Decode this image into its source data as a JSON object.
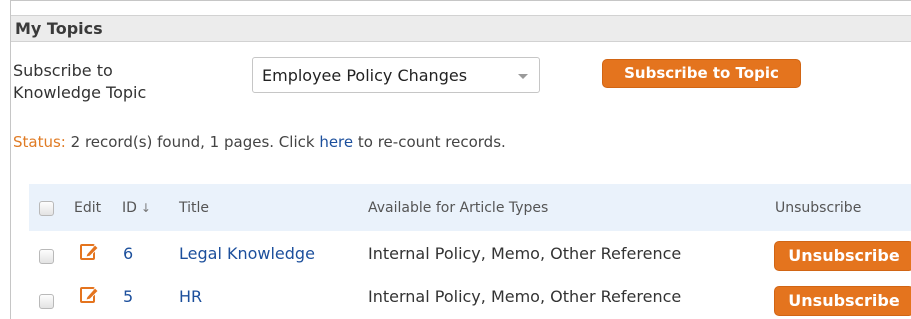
{
  "section": {
    "title": "My Topics"
  },
  "subscribe": {
    "label_line1": "Subscribe to",
    "label_line2": "Knowledge Topic",
    "selected_topic": "Employee Policy Changes",
    "button_label": "Subscribe to Topic"
  },
  "status": {
    "label": "Status:",
    "text_before_link": " 2 record(s) found, 1 pages. Click ",
    "link_text": "here",
    "text_after_link": " to re-count records."
  },
  "table": {
    "columns": {
      "edit": "Edit",
      "id": "ID",
      "title": "Title",
      "types": "Available for Article Types",
      "unsubscribe": "Unsubscribe"
    },
    "sort_icon": "↓",
    "rows": [
      {
        "id": "6",
        "title": "Legal Knowledge",
        "types": "Internal Policy, Memo, Other Reference",
        "action": "Unsubscribe"
      },
      {
        "id": "5",
        "title": "HR",
        "types": "Internal Policy, Memo, Other Reference",
        "action": "Unsubscribe"
      }
    ]
  },
  "colors": {
    "accent": "#e4741e",
    "link": "#1c4f9c",
    "header_bg": "#ececec",
    "table_header_bg": "#eaf2fb"
  }
}
